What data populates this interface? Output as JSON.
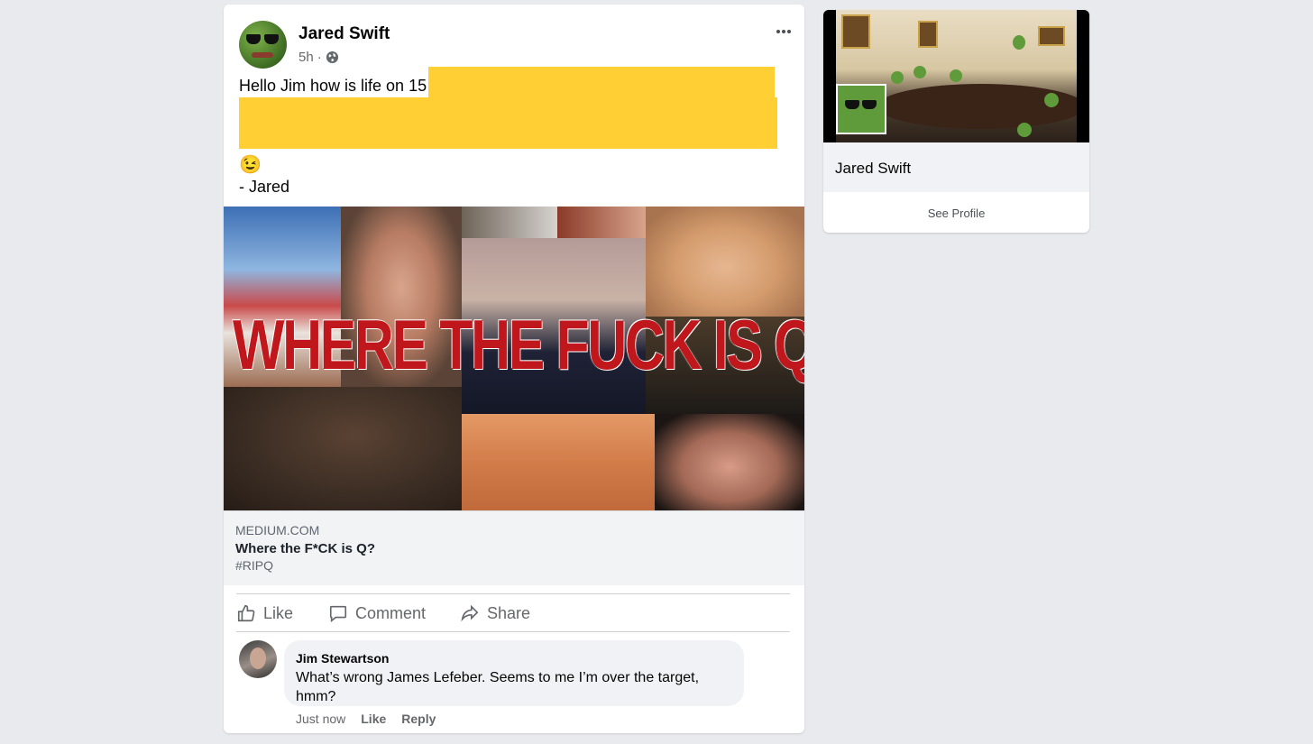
{
  "post": {
    "author_name": "Jared Swift",
    "timestamp": "5h",
    "separator": "·",
    "text_line1": "Hello Jim how is life on 15",
    "emoji": "😉",
    "signature": "- Jared"
  },
  "link_preview": {
    "headline_image_text": "WHERE THE FUCK IS Q?",
    "domain": "MEDIUM.COM",
    "title": "Where the F*CK is Q?",
    "description": "#RIPQ"
  },
  "actions": {
    "like": "Like",
    "comment": "Comment",
    "share": "Share"
  },
  "comment": {
    "author": "Jim Stewartson",
    "text": "What’s wrong James Lefeber. Seems to me I’m over the target, hmm?",
    "time": "Just now",
    "like": "Like",
    "reply": "Reply"
  },
  "profile_card": {
    "name": "Jared Swift",
    "button": "See Profile"
  },
  "colors": {
    "redaction": "#ffcf33",
    "headline_red": "#c0171c",
    "page_bg": "#e9eaed"
  }
}
